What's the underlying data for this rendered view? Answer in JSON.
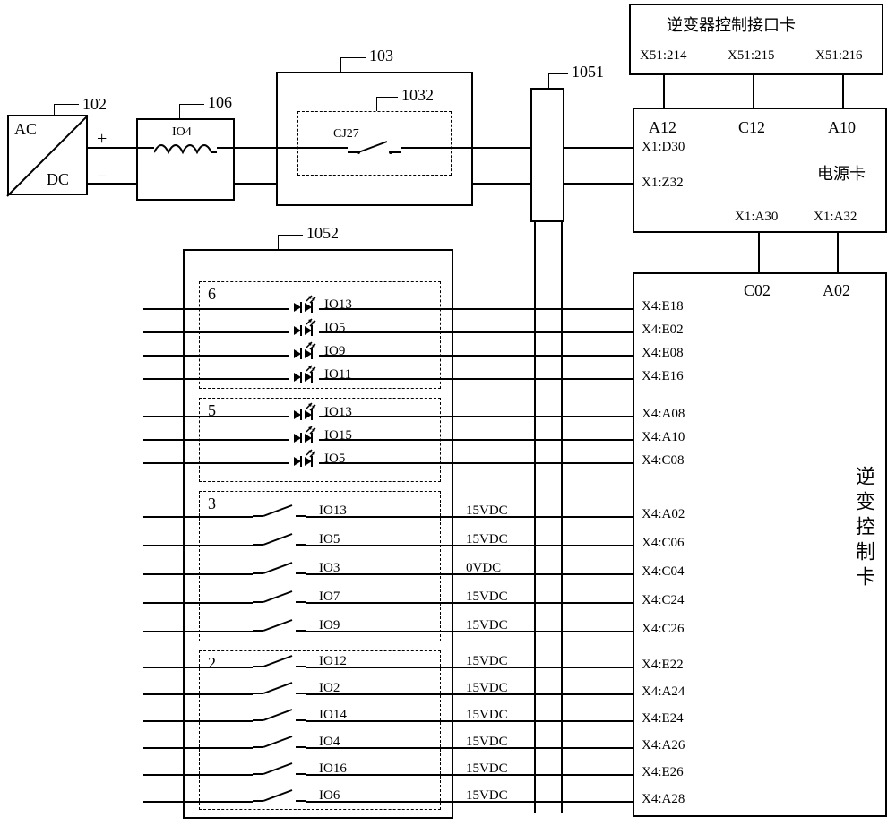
{
  "refs": {
    "r102": "102",
    "r106": "106",
    "r103": "103",
    "r1032": "1032",
    "r1051": "1051",
    "r1052": "1052"
  },
  "acdc": {
    "ac": "AC",
    "dc": "DC",
    "plus": "+",
    "minus": "−"
  },
  "inductor": {
    "name": "IO4"
  },
  "contactor": {
    "name": "CJ27"
  },
  "iface_card": {
    "title": "逆变器控制接口卡",
    "pins": [
      "X51:214",
      "X51:215",
      "X51:216"
    ]
  },
  "power_card": {
    "title": "电源卡",
    "top": [
      "A12",
      "C12",
      "A10"
    ],
    "left": [
      "X1:D30",
      "X1:Z32"
    ],
    "bottom": [
      "X1:A30",
      "X1:A32"
    ]
  },
  "ctrl_card": {
    "title": "逆变控制卡",
    "top": [
      "C02",
      "A02"
    ],
    "pins": [
      "X4:E18",
      "X4:E02",
      "X4:E08",
      "X4:E16",
      "X4:A08",
      "X4:A10",
      "X4:C08",
      "X4:A02",
      "X4:C06",
      "X4:C04",
      "X4:C24",
      "X4:C26",
      "X4:E22",
      "X4:A24",
      "X4:E24",
      "X4:A26",
      "X4:E26",
      "X4:A28"
    ]
  },
  "groups": {
    "g6": {
      "num": "6",
      "items": [
        "IO13",
        "IO5",
        "IO9",
        "IO11"
      ]
    },
    "g5": {
      "num": "5",
      "items": [
        "IO13",
        "IO15",
        "IO5"
      ]
    },
    "g3": {
      "num": "3",
      "items": [
        {
          "io": "IO13",
          "v": "15VDC"
        },
        {
          "io": "IO5",
          "v": "15VDC"
        },
        {
          "io": "IO3",
          "v": "0VDC"
        },
        {
          "io": "IO7",
          "v": "15VDC"
        },
        {
          "io": "IO9",
          "v": "15VDC"
        }
      ]
    },
    "g2": {
      "num": "2",
      "items": [
        {
          "io": "IO12",
          "v": "15VDC"
        },
        {
          "io": "IO2",
          "v": "15VDC"
        },
        {
          "io": "IO14",
          "v": "15VDC"
        },
        {
          "io": "IO4",
          "v": "15VDC"
        },
        {
          "io": "IO16",
          "v": "15VDC"
        },
        {
          "io": "IO6",
          "v": "15VDC"
        }
      ]
    }
  }
}
